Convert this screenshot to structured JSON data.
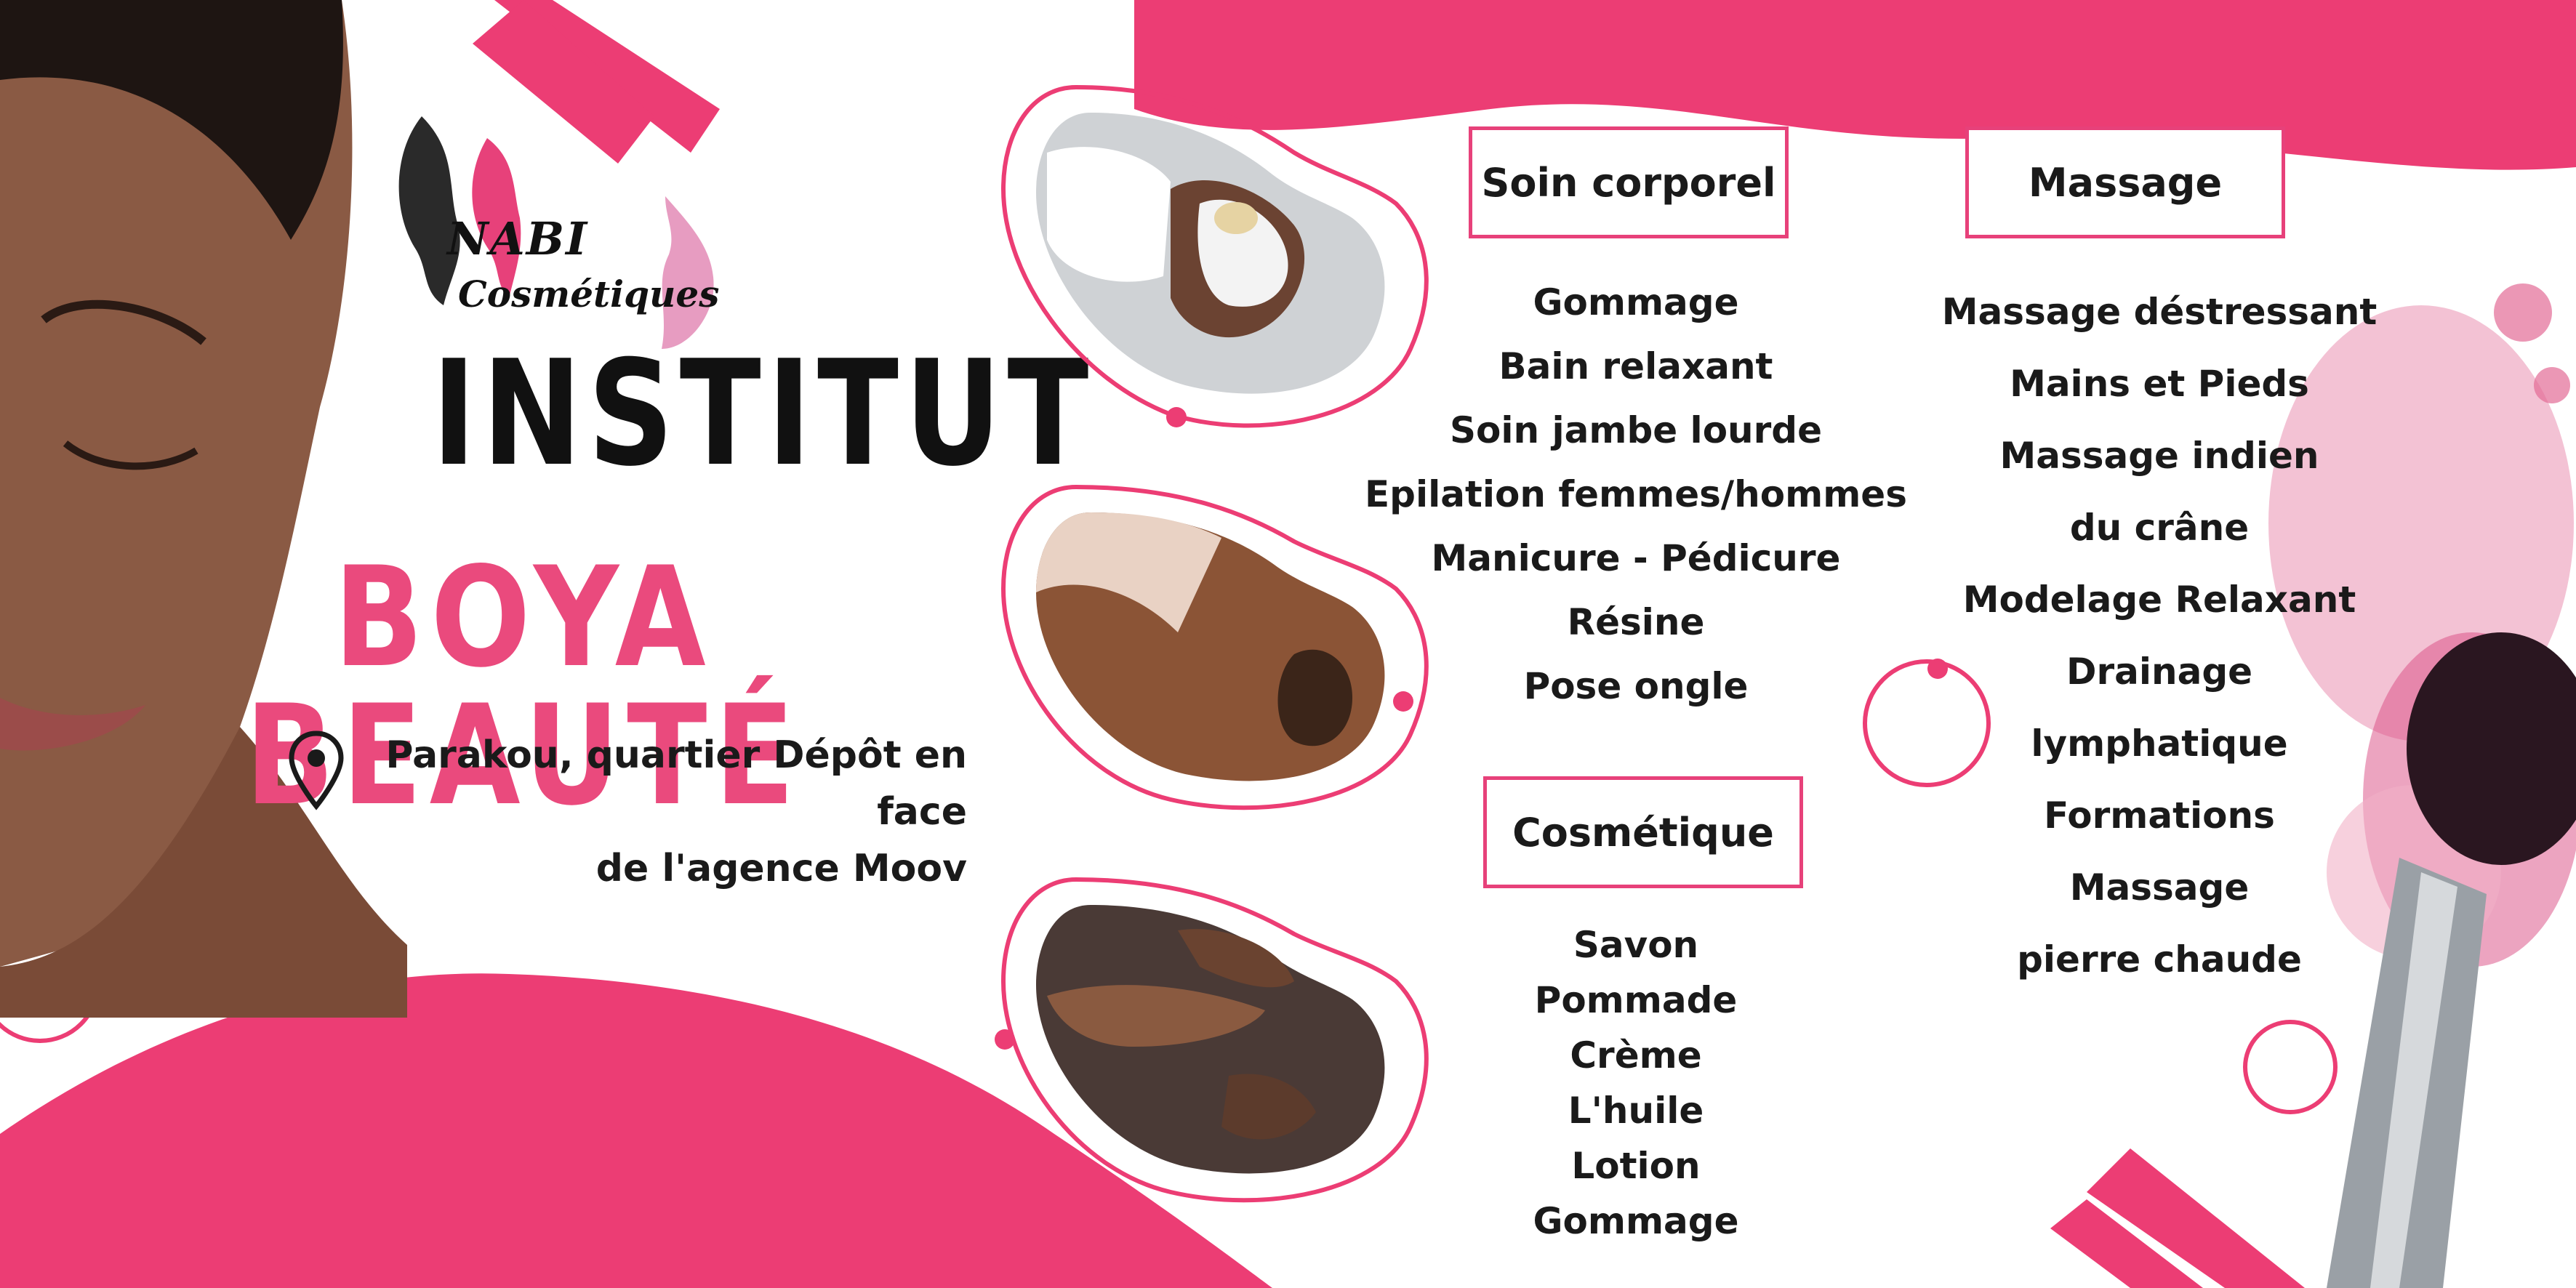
{
  "colors": {
    "accent": "#e7417a",
    "text": "#1a1a1a",
    "title": "#111111"
  },
  "logo": {
    "line1": "NABI",
    "line2": "Cosmétiques"
  },
  "title": {
    "line1": "INSTITUT",
    "line2": "BOYA BEAUTÉ"
  },
  "address": {
    "line1": "Parakou, quartier Dépôt en face",
    "line2": "de l'agence Moov",
    "icon": "location-pin-icon"
  },
  "sections": {
    "soin": {
      "label": "Soin corporel",
      "items": [
        "Gommage",
        "Bain relaxant",
        "Soin jambe lourde",
        "Epilation femmes/hommes",
        "Manicure - Pédicure",
        "Résine",
        "Pose ongle"
      ]
    },
    "massage": {
      "label": "Massage",
      "items": [
        "Massage déstressant",
        "Mains et Pieds",
        "Massage indien",
        "du crâne",
        "Modelage Relaxant",
        "Drainage",
        "lymphatique",
        "Formations",
        "Massage",
        "pierre chaude"
      ]
    },
    "cosmetique": {
      "label": "Cosmétique",
      "items": [
        "Savon",
        "Pommade",
        "Crème",
        "L'huile",
        "Lotion",
        "Gommage"
      ]
    }
  }
}
